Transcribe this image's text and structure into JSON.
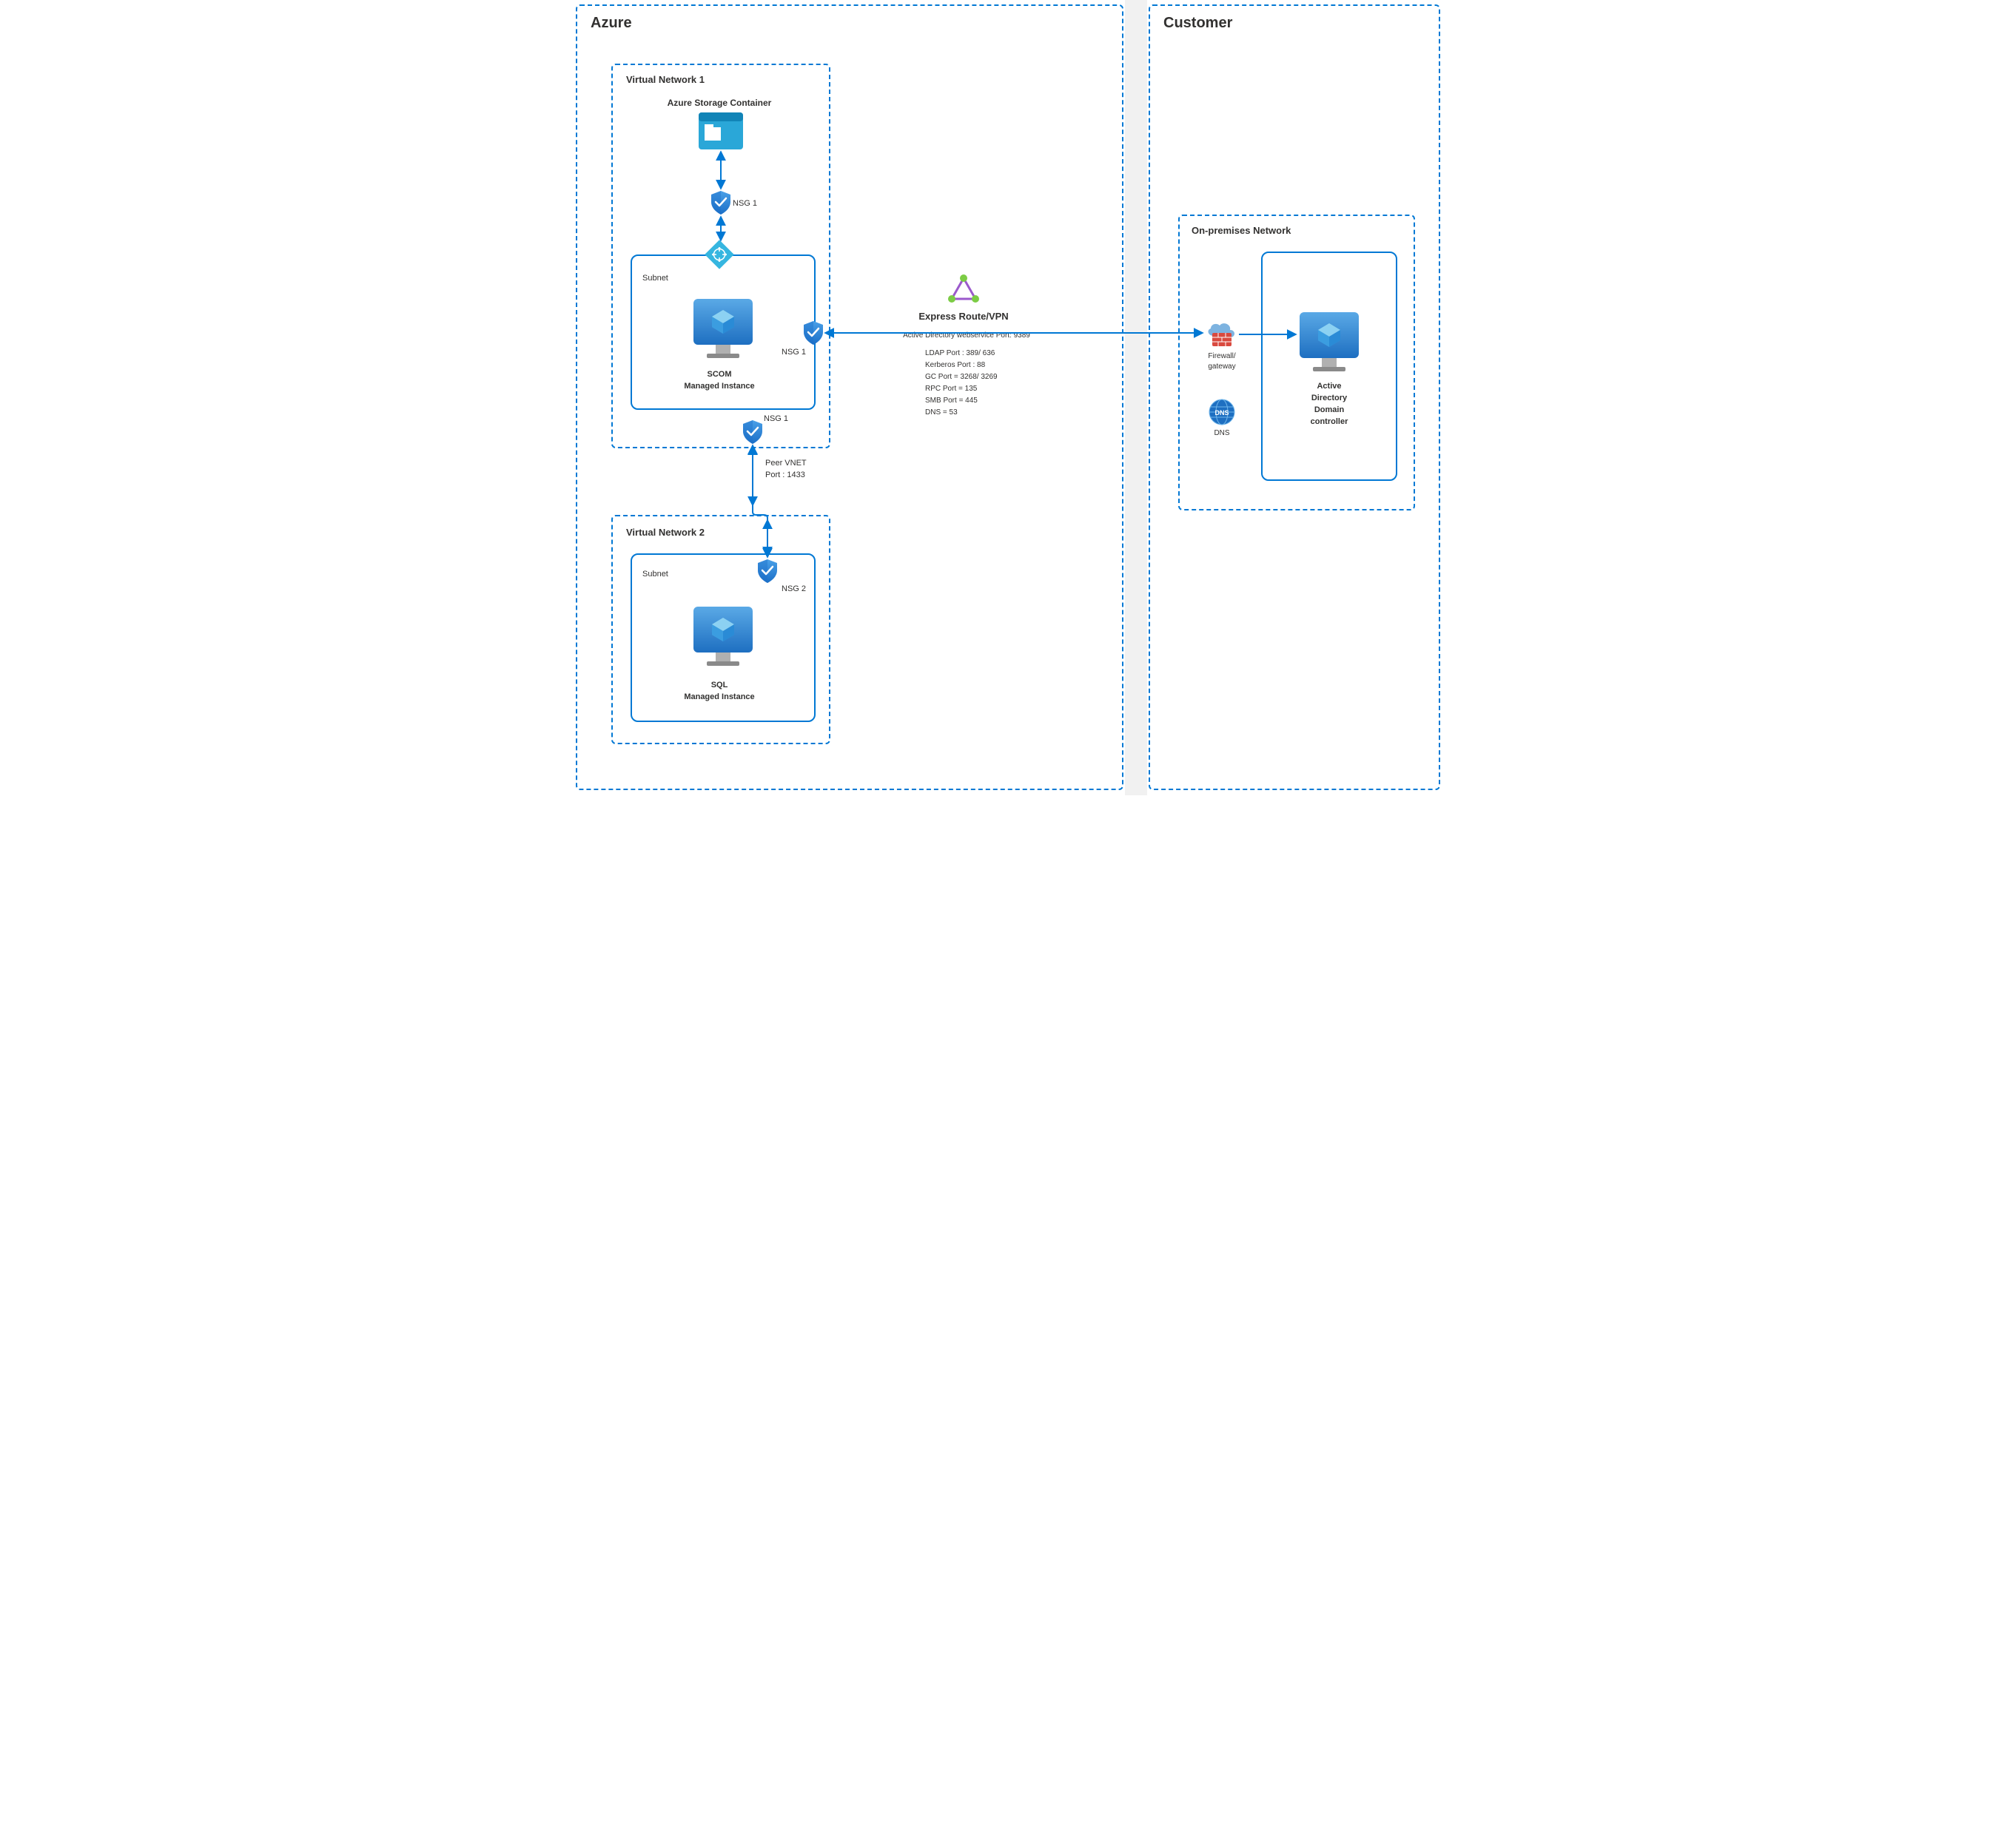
{
  "azure": {
    "title": "Azure",
    "vnet1": {
      "title": "Virtual Network 1",
      "storage": {
        "label": "Azure Storage Container"
      },
      "nsg_top": "NSG 1",
      "nat": "NAT Gateway",
      "subnet_label": "Subnet",
      "scom_line1": "SCOM",
      "scom_line2": "Managed Instance",
      "nsg_right": "NSG 1",
      "nsg_bottom": "NSG 1"
    },
    "peer": {
      "line1": "Peer VNET",
      "line2": "Port : 1433"
    },
    "vnet2": {
      "title": "Virtual Network 2",
      "subnet_label": "Subnet",
      "nsg": "NSG 2",
      "sql_line1": "SQL",
      "sql_line2": "Managed Instance"
    }
  },
  "center": {
    "title": "Express Route/VPN",
    "sub": "Active Directory webservice Port: 9389",
    "ports": [
      "LDAP Port : 389/ 636",
      "Kerberos Port : 88",
      "GC Port = 3268/ 3269",
      "RPC Port = 135",
      "SMB Port = 445",
      "DNS = 53"
    ]
  },
  "customer": {
    "title": "Customer",
    "onprem": "On-premises Network",
    "firewall_line1": "Firewall/",
    "firewall_line2": "gateway",
    "dns": "DNS",
    "addc_line1": "Active",
    "addc_line2": "Directory",
    "addc_line3": "Domain",
    "addc_line4": "controller"
  },
  "icons": {
    "storage": "storage-container-icon",
    "shield": "shield-icon",
    "nat": "nat-gateway-icon",
    "monitor": "server-monitor-icon",
    "express": "express-route-icon",
    "firewall": "firewall-icon",
    "dns": "dns-icon"
  }
}
